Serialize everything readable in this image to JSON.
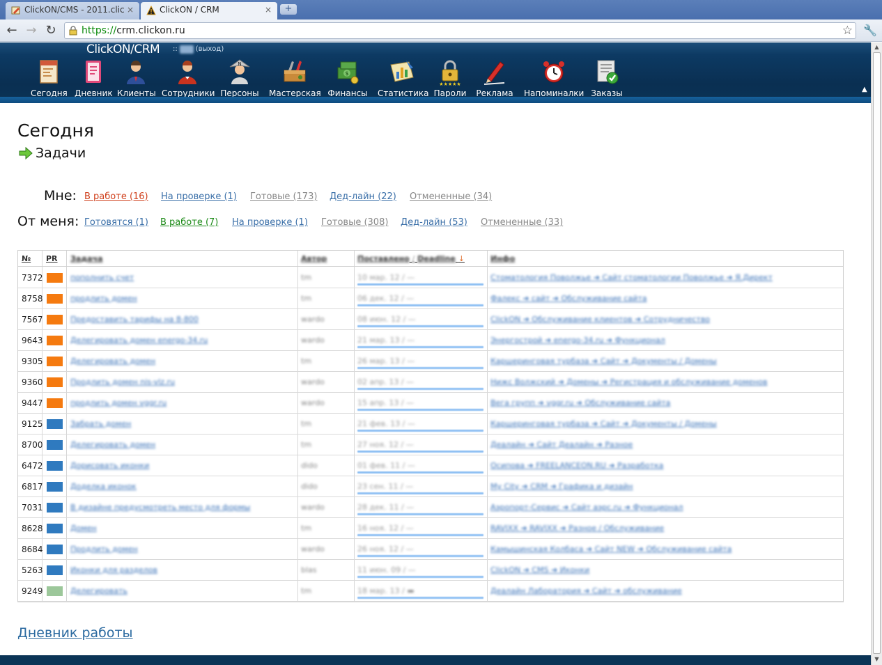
{
  "browser": {
    "tabs": [
      {
        "title": "ClickON/CMS - 2011.clic",
        "close": "×"
      },
      {
        "title": "ClickON / CRM",
        "close": "×"
      }
    ],
    "new_tab": "+",
    "url_scheme": "https://",
    "url_host": "crm.clickon.ru",
    "back": "←",
    "forward": "→",
    "reload": "↻",
    "star": "☆",
    "wrench": "🔧"
  },
  "header": {
    "brand": "ClickON/CRM",
    "sub_prefix": "::",
    "sub_blurred": "blur",
    "logout": "(выход)",
    "modules": [
      {
        "label": "Сегодня",
        "icon": "calendar-icon"
      },
      {
        "label": "Дневник",
        "icon": "diary-icon"
      },
      {
        "label": "Клиенты",
        "icon": "client-icon"
      },
      {
        "label": "Сотрудники",
        "icon": "employee-icon"
      },
      {
        "label": "Персоны",
        "icon": "person-icon"
      },
      {
        "label": "Мастерская",
        "icon": "toolbox-icon"
      },
      {
        "label": "Финансы",
        "icon": "money-icon"
      },
      {
        "label": "Статистика",
        "icon": "statistics-icon"
      },
      {
        "label": "Пароли",
        "icon": "lock-icon"
      },
      {
        "label": "Реклама",
        "icon": "pen-icon"
      },
      {
        "label": "Напоминалки",
        "icon": "alarm-clock-icon"
      },
      {
        "label": "Заказы",
        "icon": "order-check-icon"
      }
    ],
    "up_arrow": "▲"
  },
  "page": {
    "title": "Сегодня",
    "subtitle": "Задачи"
  },
  "filters": {
    "mine": {
      "label": "Мне:",
      "links": [
        {
          "text": "В работе (16)",
          "style": "red"
        },
        {
          "text": "На проверке (1)",
          "style": "blue"
        },
        {
          "text": "Готовые (173)",
          "style": "gray"
        },
        {
          "text": "Дед-лайн (22)",
          "style": "blue"
        },
        {
          "text": "Отмененные (34)",
          "style": "gray"
        }
      ]
    },
    "from_me": {
      "label": "От меня:",
      "links": [
        {
          "text": "Готовятся (1)",
          "style": "blue"
        },
        {
          "text": "В работе (7)",
          "style": "green"
        },
        {
          "text": "На проверке (1)",
          "style": "blue"
        },
        {
          "text": "Готовые (308)",
          "style": "gray"
        },
        {
          "text": "Дед-лайн (53)",
          "style": "blue"
        },
        {
          "text": "Отмененные (33)",
          "style": "gray"
        }
      ]
    }
  },
  "table": {
    "headers": {
      "num": "№",
      "pr": "PR",
      "task": "Задача",
      "author": "Автор",
      "posted": "Поставлено",
      "deadline": "Deadline",
      "info": "Инфо",
      "sort": "↓"
    },
    "colors": {
      "orange": "#f57a0f",
      "blue": "#2f7abf",
      "green": "#9cc79a"
    },
    "rows": [
      {
        "num": "7372",
        "pr": "orange",
        "task": "пополнить счет",
        "author": "tm",
        "date": "10 мар. 12  /  —",
        "info": "Стоматология Поволжье ➜ Сайт стоматологии Поволжье ➜ Я.Директ"
      },
      {
        "num": "8758",
        "pr": "orange",
        "task": "продлить домен",
        "author": "tm",
        "date": "06 дек. 12  /  —",
        "info": "Фалекс ➜ сайт ➜ Обслуживание сайта"
      },
      {
        "num": "7567",
        "pr": "orange",
        "task": "Предоставить тарифы на 8-800",
        "author": "wardo",
        "date": "08 июн. 12  /  —",
        "info": "ClickON ➜ Обслуживание клиентов ➜ Сотрудничество"
      },
      {
        "num": "9643",
        "pr": "orange",
        "task": "Делегировать домен energo-34.ru",
        "author": "wardo",
        "date": "21 мар. 13  /  —",
        "info": "Энергострой ➜ energo-34.ru ➜ Функционал"
      },
      {
        "num": "9305",
        "pr": "orange",
        "task": "Делегировать домен",
        "author": "tm",
        "date": "26 мар. 13  /  —",
        "info": "Каршеринговая турбаза ➜ Сайт ➜ Документы / Домены"
      },
      {
        "num": "9360",
        "pr": "orange",
        "task": "Продлить домен nis-vlz.ru",
        "author": "wardo",
        "date": "02 апр. 13  /  —",
        "info": "Нижс Волжский ➜ Домены ➜ Регистрация и обслуживание доменов"
      },
      {
        "num": "9447",
        "pr": "orange",
        "task": "продлить домен vggr.ru",
        "author": "wardo",
        "date": "15 апр. 13  /  —",
        "info": "Вега групп ➜ vggr.ru ➜ Обслуживание сайта"
      },
      {
        "num": "9125",
        "pr": "blue",
        "task": "Забрать домен",
        "author": "tm",
        "date": "21 фев. 13  /  —",
        "info": "Каршеринговая турбаза ➜ Сайт ➜ Документы / Домены"
      },
      {
        "num": "8700",
        "pr": "blue",
        "task": "Делегировать домен",
        "author": "tm",
        "date": "27 ноя. 12  /  —",
        "info": "Деалайн ➜ Сайт Деалайн ➜ Разное"
      },
      {
        "num": "6472",
        "pr": "blue",
        "task": "Дорисовать иконки",
        "author": "dido",
        "date": "01 фев. 11  /  —",
        "info": "Осипова ➜ FREELANCEON.RU ➜ Разработка"
      },
      {
        "num": "6817",
        "pr": "blue",
        "task": "Доделка иконок",
        "author": "dido",
        "date": "23 сен. 11  /  —",
        "info": "My City ➜ CRM ➜ Графика и дизайн"
      },
      {
        "num": "7031",
        "pr": "blue",
        "task": "В дизайне предусмотреть место для формы",
        "author": "wardo",
        "date": "28 дек. 11  /  —",
        "info": "Аэропорт-Сервис ➜ Сайт аэрс.ru ➜ Функционал"
      },
      {
        "num": "8628",
        "pr": "blue",
        "task": "Домен",
        "author": "tm",
        "date": "16 ноя. 12  /  —",
        "info": "RAVIXX ➜ RAVIXX ➜ Разное / Обслуживание"
      },
      {
        "num": "8684",
        "pr": "blue",
        "task": "Продлить домен",
        "author": "wardo",
        "date": "26 ноя. 12  /  —",
        "info": "Камышинская Колбаса ➜ Сайт NEW ➜ Обслуживание сайта"
      },
      {
        "num": "5263",
        "pr": "blue",
        "task": "Иконки для разделов",
        "author": "blas",
        "date": "11 июн. 09  /  —",
        "info": "ClickON ➜ CMS ➜ Иконки"
      },
      {
        "num": "9249",
        "pr": "green",
        "task": "Делегировать",
        "author": "tm",
        "date": "18 мар. 13  /  ▬",
        "info": "Деалайн Лаборатория ➜ Сайт ➜ обслуживание"
      }
    ]
  },
  "footer": {
    "diary_link": "Дневник работы"
  },
  "scrollbar": {
    "up": "▲",
    "down": "▼"
  }
}
